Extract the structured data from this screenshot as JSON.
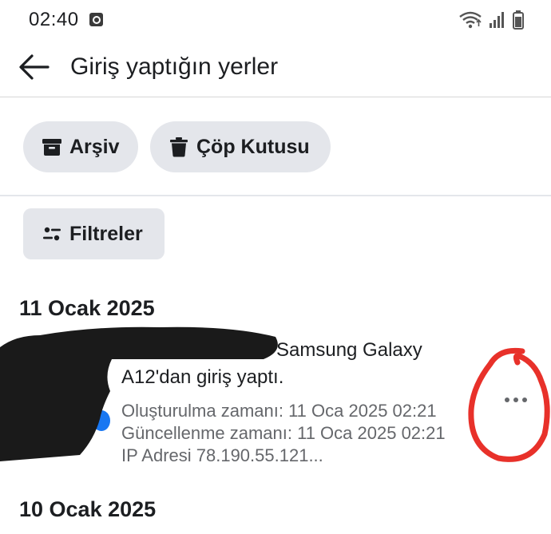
{
  "status_bar": {
    "time": "02:40"
  },
  "header": {
    "title": "Giriş yaptığın yerler"
  },
  "actions": {
    "archive_label": "Arşiv",
    "trash_label": "Çöp Kutusu",
    "filter_label": "Filtreler"
  },
  "groups": [
    {
      "date": "11 Ocak 2025",
      "entry": {
        "title_line1": "Samsung Galaxy",
        "title_line2": "A12'dan giriş yaptı.",
        "created": "Oluşturulma zamanı: 11 Oca 2025 02:21",
        "updated": "Güncellenme zamanı: 11 Oca 2025 02:21",
        "ip": "IP Adresi 78.190.55.121..."
      }
    },
    {
      "date": "10 Ocak 2025"
    }
  ],
  "colors": {
    "chip_bg": "#e4e6eb",
    "text_primary": "#1c1e21",
    "text_secondary": "#65676b",
    "annotation_red": "#e8312a",
    "redaction": "#1a1a1a"
  },
  "icons": [
    "back-arrow-icon",
    "archive-icon",
    "trash-icon",
    "filter-icon",
    "more-icon",
    "wifi-icon",
    "signal-icon",
    "battery-icon"
  ]
}
